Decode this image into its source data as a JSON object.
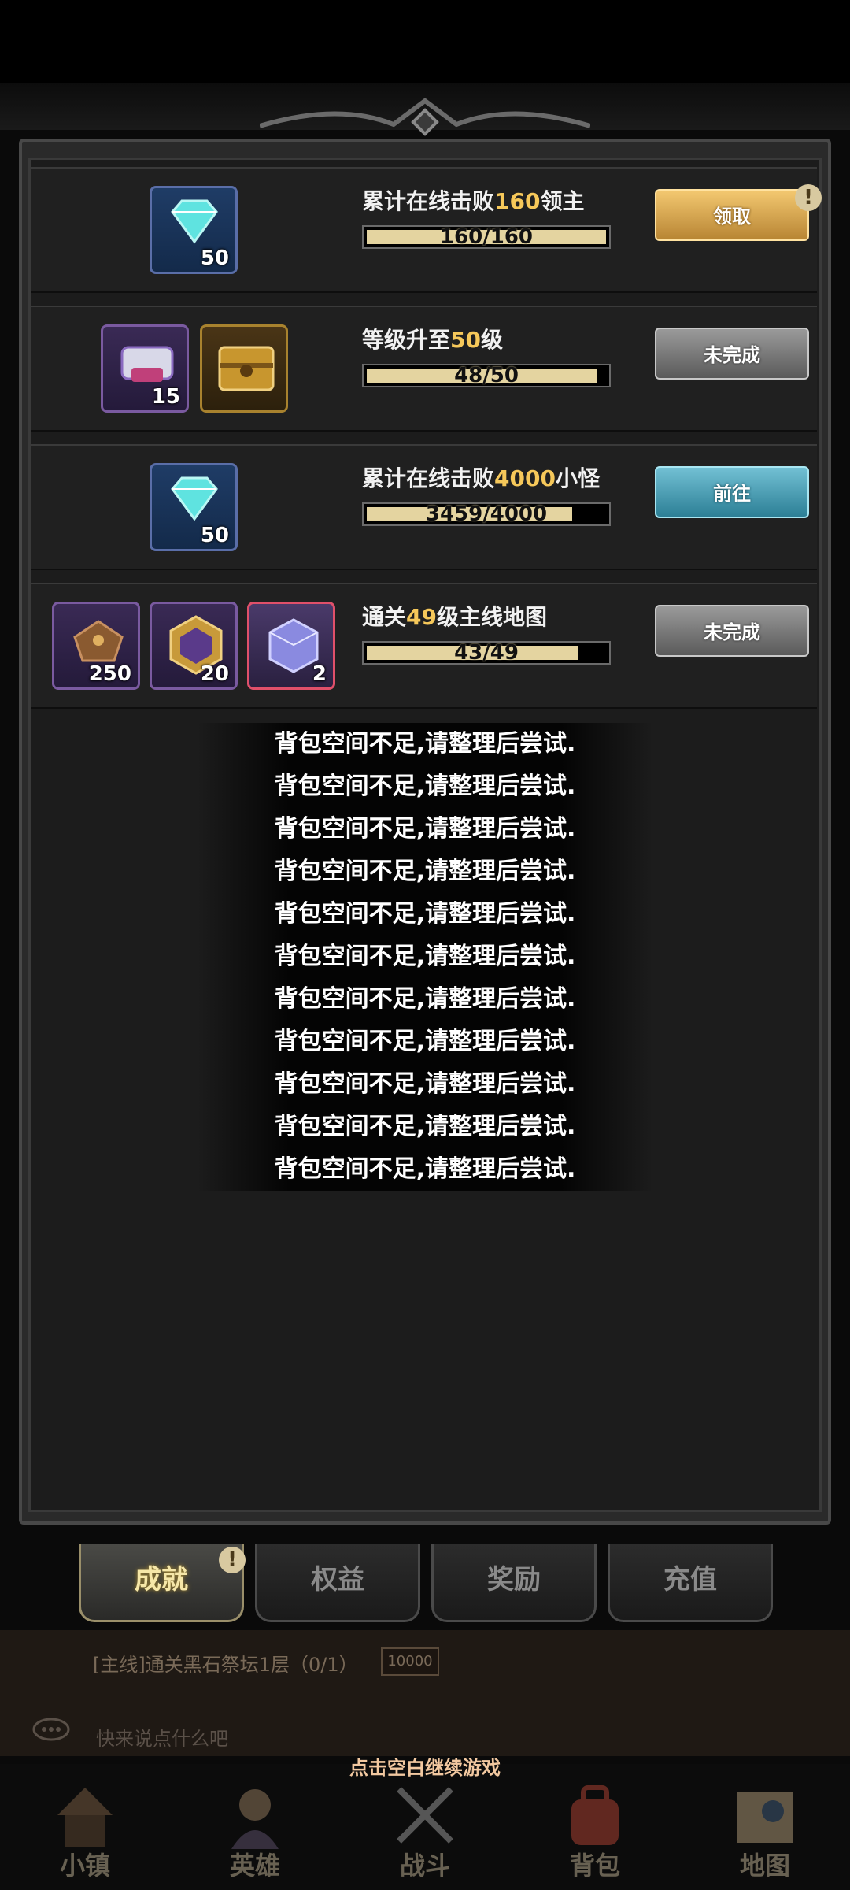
{
  "tasks": [
    {
      "title_prefix": "累计在线击败",
      "title_highlight": "160",
      "title_suffix": "领主",
      "progress_text": "160/160",
      "progress": 1.0,
      "button": "领取",
      "button_state": "claim",
      "rewards": [
        {
          "icon": "diamond-icon",
          "qty": "50",
          "frame": "blue"
        }
      ]
    },
    {
      "title_prefix": "等级升至",
      "title_highlight": "50",
      "title_suffix": "级",
      "progress_text": "48/50",
      "progress": 0.96,
      "button": "未完成",
      "button_state": "todo",
      "rewards": [
        {
          "icon": "treasure-bag-icon",
          "qty": "15",
          "frame": "purple"
        },
        {
          "icon": "golden-chest-icon",
          "qty": "",
          "frame": "gold"
        }
      ]
    },
    {
      "title_prefix": "累计在线击败",
      "title_highlight": "4000",
      "title_suffix": "小怪",
      "progress_text": "3459/4000",
      "progress": 0.86,
      "button": "前往",
      "button_state": "goto",
      "rewards": [
        {
          "icon": "diamond-icon",
          "qty": "50",
          "frame": "blue"
        }
      ]
    },
    {
      "title_prefix": "通关",
      "title_highlight": "49",
      "title_suffix": "级主线地图",
      "progress_text": "43/49",
      "progress": 0.88,
      "button": "未完成",
      "button_state": "todo",
      "rewards": [
        {
          "icon": "chest-icon",
          "qty": "250",
          "frame": "purple"
        },
        {
          "icon": "shield-emblem-icon",
          "qty": "20",
          "frame": "purple"
        },
        {
          "icon": "crystal-cube-icon",
          "qty": "2",
          "frame": "red"
        }
      ]
    }
  ],
  "toast_message": "背包空间不足,请整理后尝试.",
  "toast_count": 11,
  "tabs": [
    "成就",
    "权益",
    "奖励",
    "充值"
  ],
  "active_tab": 0,
  "quest_text": "[主线]通关黑石祭坛1层（0/1）",
  "quest_badge": "10000",
  "chat_placeholder": "快来说点什么吧",
  "continue_hint": "点击空白继续游戏",
  "nav": [
    "小镇",
    "英雄",
    "战斗",
    "背包",
    "地图"
  ],
  "colors": {
    "highlight": "#f6c85a",
    "progress_fill": "#e4d4a0",
    "claim": "#e0b050",
    "goto": "#4fa5bd"
  }
}
